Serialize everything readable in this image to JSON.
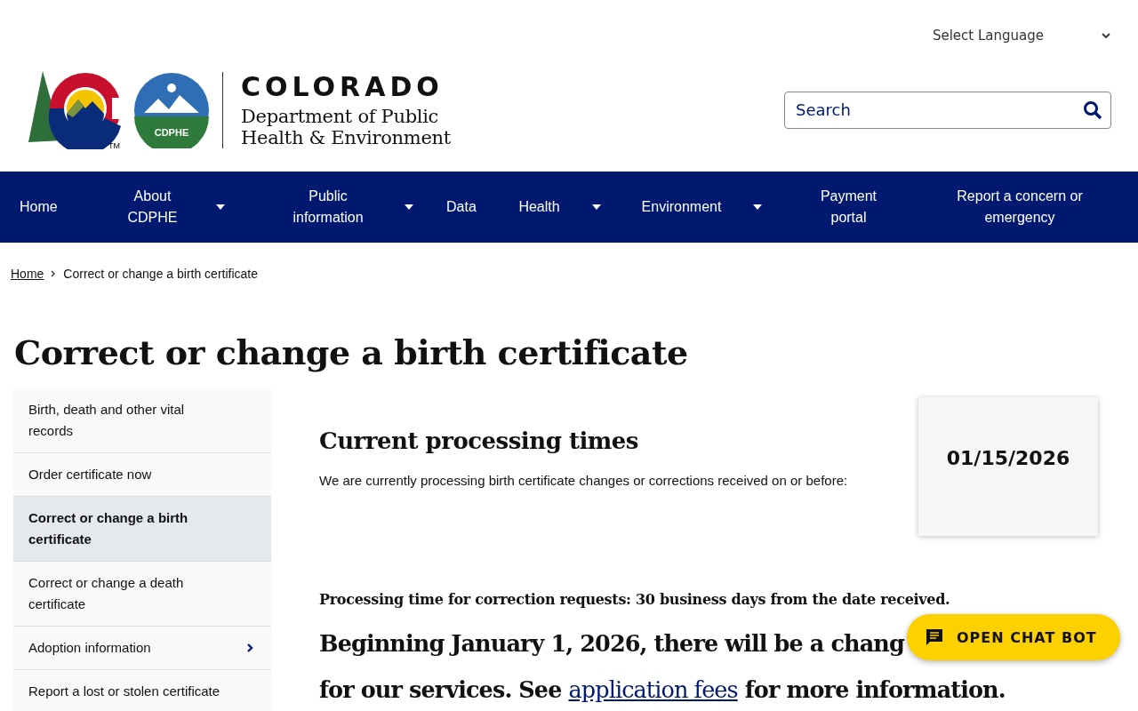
{
  "language_select": {
    "label": "Select Language"
  },
  "logo": {
    "state": "COLORADO",
    "department_line_1": "Department of Public",
    "department_line_2": "Health & Environment",
    "seal_text": "CDPHE",
    "trademark": "TM"
  },
  "search": {
    "placeholder": "Search"
  },
  "nav": [
    {
      "label": "Home",
      "dropdown": false
    },
    {
      "label": "About CDPHE",
      "dropdown": true
    },
    {
      "label": "Public information",
      "dropdown": true
    },
    {
      "label": "Data",
      "dropdown": false
    },
    {
      "label": "Health",
      "dropdown": true
    },
    {
      "label": "Environment",
      "dropdown": true
    },
    {
      "label": "Payment portal",
      "dropdown": false
    },
    {
      "label": "Report a concern or emergency",
      "dropdown": false
    }
  ],
  "breadcrumb": [
    {
      "label": "Home",
      "link": true
    },
    {
      "label": "Correct or change a birth certificate",
      "link": false
    }
  ],
  "page_title": "Correct or change a birth certificate",
  "sidebar": [
    {
      "label": "Birth, death and other vital records",
      "selected": false,
      "has_children": false
    },
    {
      "label": "Order certificate now",
      "selected": false,
      "has_children": false
    },
    {
      "label": "Correct or change a birth certificate",
      "selected": true,
      "has_children": false
    },
    {
      "label": "Correct or change a death certificate",
      "selected": false,
      "has_children": false
    },
    {
      "label": "Adoption information",
      "selected": false,
      "has_children": true
    },
    {
      "label": "Report a lost or stolen certificate",
      "selected": false,
      "has_children": false
    }
  ],
  "processing": {
    "heading": "Current processing times",
    "text": "We are currently processing birth certificate changes or corrections received on or before:",
    "date": "01/15/2026"
  },
  "notice": {
    "processing_time": "Processing time for correction requests: 30 business days from the date received.",
    "line_1": "Beginning January 1, 2026, there will be a chang",
    "line_2_before": "for our services. See",
    "link": "application fees",
    "line_2_after": "for more information."
  },
  "chat_button": {
    "label": "OPEN CHAT BOT"
  }
}
